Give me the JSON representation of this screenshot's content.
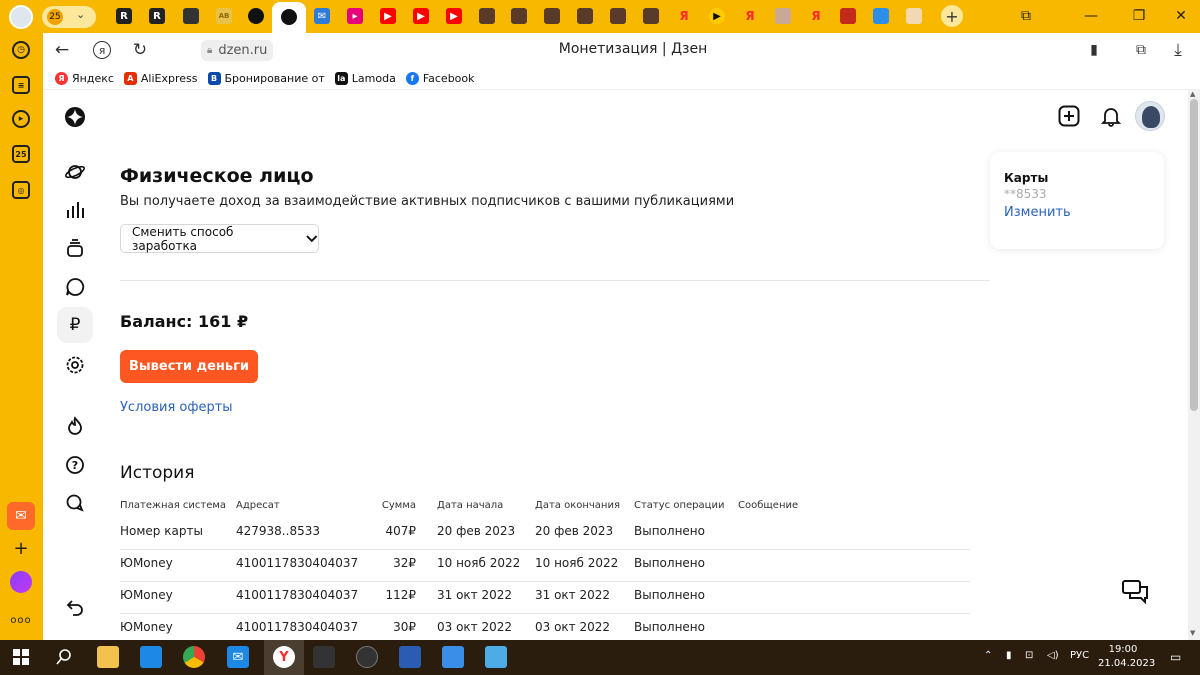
{
  "browser": {
    "tab_counter": "25",
    "tab_badges": [
      "R",
      "R",
      "AB",
      "Я",
      "Я",
      "Я",
      "Я"
    ],
    "url": "dzen.ru",
    "title": "Монетизация | Дзен",
    "new_tab": "+"
  },
  "left_rail": {
    "badge_25": "25",
    "more": "ооо"
  },
  "bookmarks": [
    {
      "label": "Яндекс",
      "icon_char": "Я",
      "color": "#ff3333"
    },
    {
      "label": "AliExpress",
      "icon_char": "A",
      "color": "#e62e04"
    },
    {
      "label": "Бронирование от",
      "icon_char": "B",
      "color": "#0a4aa8"
    },
    {
      "label": "Lamoda",
      "icon_char": "la",
      "color": "#111111"
    },
    {
      "label": "Facebook",
      "icon_char": "f",
      "color": "#1877f2"
    }
  ],
  "main": {
    "heading": "Физическое лицо",
    "subheading": "Вы получаете доход за взаимодействие активных подписчиков с вашими публикациями",
    "dropdown_label": "Сменить способ заработка",
    "balance": "Баланс: 161 ₽",
    "withdraw_button": "Вывести деньги",
    "offer_link": "Условия оферты",
    "history_title": "История",
    "sidebar_active_symbol": "₽"
  },
  "cards": {
    "title": "Карты",
    "number": "**8533",
    "change_link": "Изменить"
  },
  "history": {
    "columns": [
      "Платежная система",
      "Адресат",
      "Сумма",
      "Дата начала",
      "Дата окончания",
      "Статус операции",
      "Сообщение"
    ],
    "rows": [
      [
        "Номер карты",
        "427938..8533",
        "407₽",
        "20 фев 2023",
        "20 фев 2023",
        "Выполнено",
        ""
      ],
      [
        "ЮMoney",
        "4100117830404037",
        "32₽",
        "10 нояб 2022",
        "10 нояб 2022",
        "Выполнено",
        ""
      ],
      [
        "ЮMoney",
        "4100117830404037",
        "112₽",
        "31 окт 2022",
        "31 окт 2022",
        "Выполнено",
        ""
      ],
      [
        "ЮMoney",
        "4100117830404037",
        "30₽",
        "03 окт 2022",
        "03 окт 2022",
        "Выполнено",
        ""
      ]
    ]
  },
  "taskbar": {
    "language": "РУС",
    "time": "19:00",
    "date": "21.04.2023"
  },
  "colors": {
    "browser_frame": "#f8b800",
    "accent_button": "#ff5722",
    "link": "#2a62b8",
    "taskbar": "#2b1d0e"
  }
}
